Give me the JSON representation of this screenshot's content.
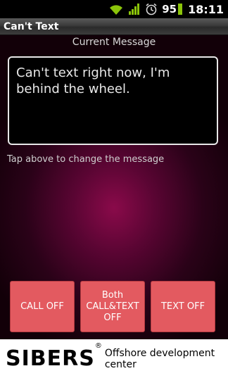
{
  "status_bar": {
    "battery_level": "95",
    "clock": "18:11",
    "icons": [
      "wifi-icon",
      "signal-icon",
      "alarm-icon",
      "battery-icon"
    ]
  },
  "app": {
    "title": "Can't Text"
  },
  "main": {
    "current_label": "Current Message",
    "message": "Can't text right now, I'm behind the wheel.",
    "hint": "Tap above to change the message"
  },
  "buttons": {
    "call_off": "CALL OFF",
    "both_off_line1": "Both",
    "both_off_line2": "CALL&TEXT",
    "both_off_line3": "OFF",
    "text_off": "TEXT OFF"
  },
  "ad": {
    "logo": "SIBERS",
    "reg_mark": "®",
    "tagline_line1": "Offshore development",
    "tagline_line2": "center"
  },
  "colors": {
    "button_bg": "#e35a60",
    "background_center": "#8a0a4a"
  }
}
